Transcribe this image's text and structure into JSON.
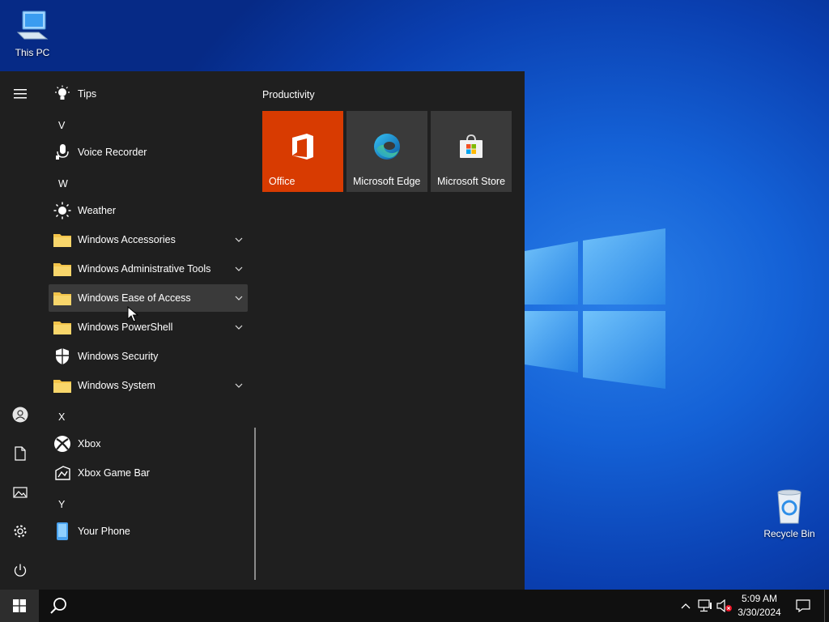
{
  "desktop": {
    "icons": [
      {
        "label": "This PC",
        "icon": "computer-icon"
      },
      {
        "label": "Recycle Bin",
        "icon": "recycle-bin-icon"
      }
    ]
  },
  "start_menu": {
    "apps": [
      {
        "label": "Tips",
        "icon": "lightbulb-icon"
      },
      {
        "letter": "V"
      },
      {
        "label": "Voice Recorder",
        "icon": "microphone-icon"
      },
      {
        "letter": "W"
      },
      {
        "label": "Weather",
        "icon": "sun-icon"
      },
      {
        "label": "Windows Accessories",
        "icon": "folder-icon",
        "expandable": true
      },
      {
        "label": "Windows Administrative Tools",
        "icon": "folder-icon",
        "expandable": true
      },
      {
        "label": "Windows Ease of Access",
        "icon": "folder-icon",
        "expandable": true,
        "hovered": true
      },
      {
        "label": "Windows PowerShell",
        "icon": "folder-icon",
        "expandable": true
      },
      {
        "label": "Windows Security",
        "icon": "shield-icon"
      },
      {
        "label": "Windows System",
        "icon": "folder-icon",
        "expandable": true
      },
      {
        "letter": "X"
      },
      {
        "label": "Xbox",
        "icon": "xbox-icon"
      },
      {
        "label": "Xbox Game Bar",
        "icon": "game-bar-icon"
      },
      {
        "letter": "Y"
      },
      {
        "label": "Your Phone",
        "icon": "phone-icon"
      }
    ],
    "tile_group": "Productivity",
    "tiles": [
      {
        "label": "Office",
        "color": "#d83b01"
      },
      {
        "label": "Microsoft Edge",
        "color": "#3a3a3a"
      },
      {
        "label": "Microsoft Store",
        "color": "#3a3a3a"
      }
    ]
  },
  "taskbar": {
    "time": "5:09 AM",
    "date": "3/30/2024"
  },
  "colors": {
    "accent": "#0a5bd6",
    "start_bg": "#1f1f1f",
    "taskbar_bg": "#101010",
    "office_tile": "#d83b01",
    "folder": "#f3c44a"
  }
}
